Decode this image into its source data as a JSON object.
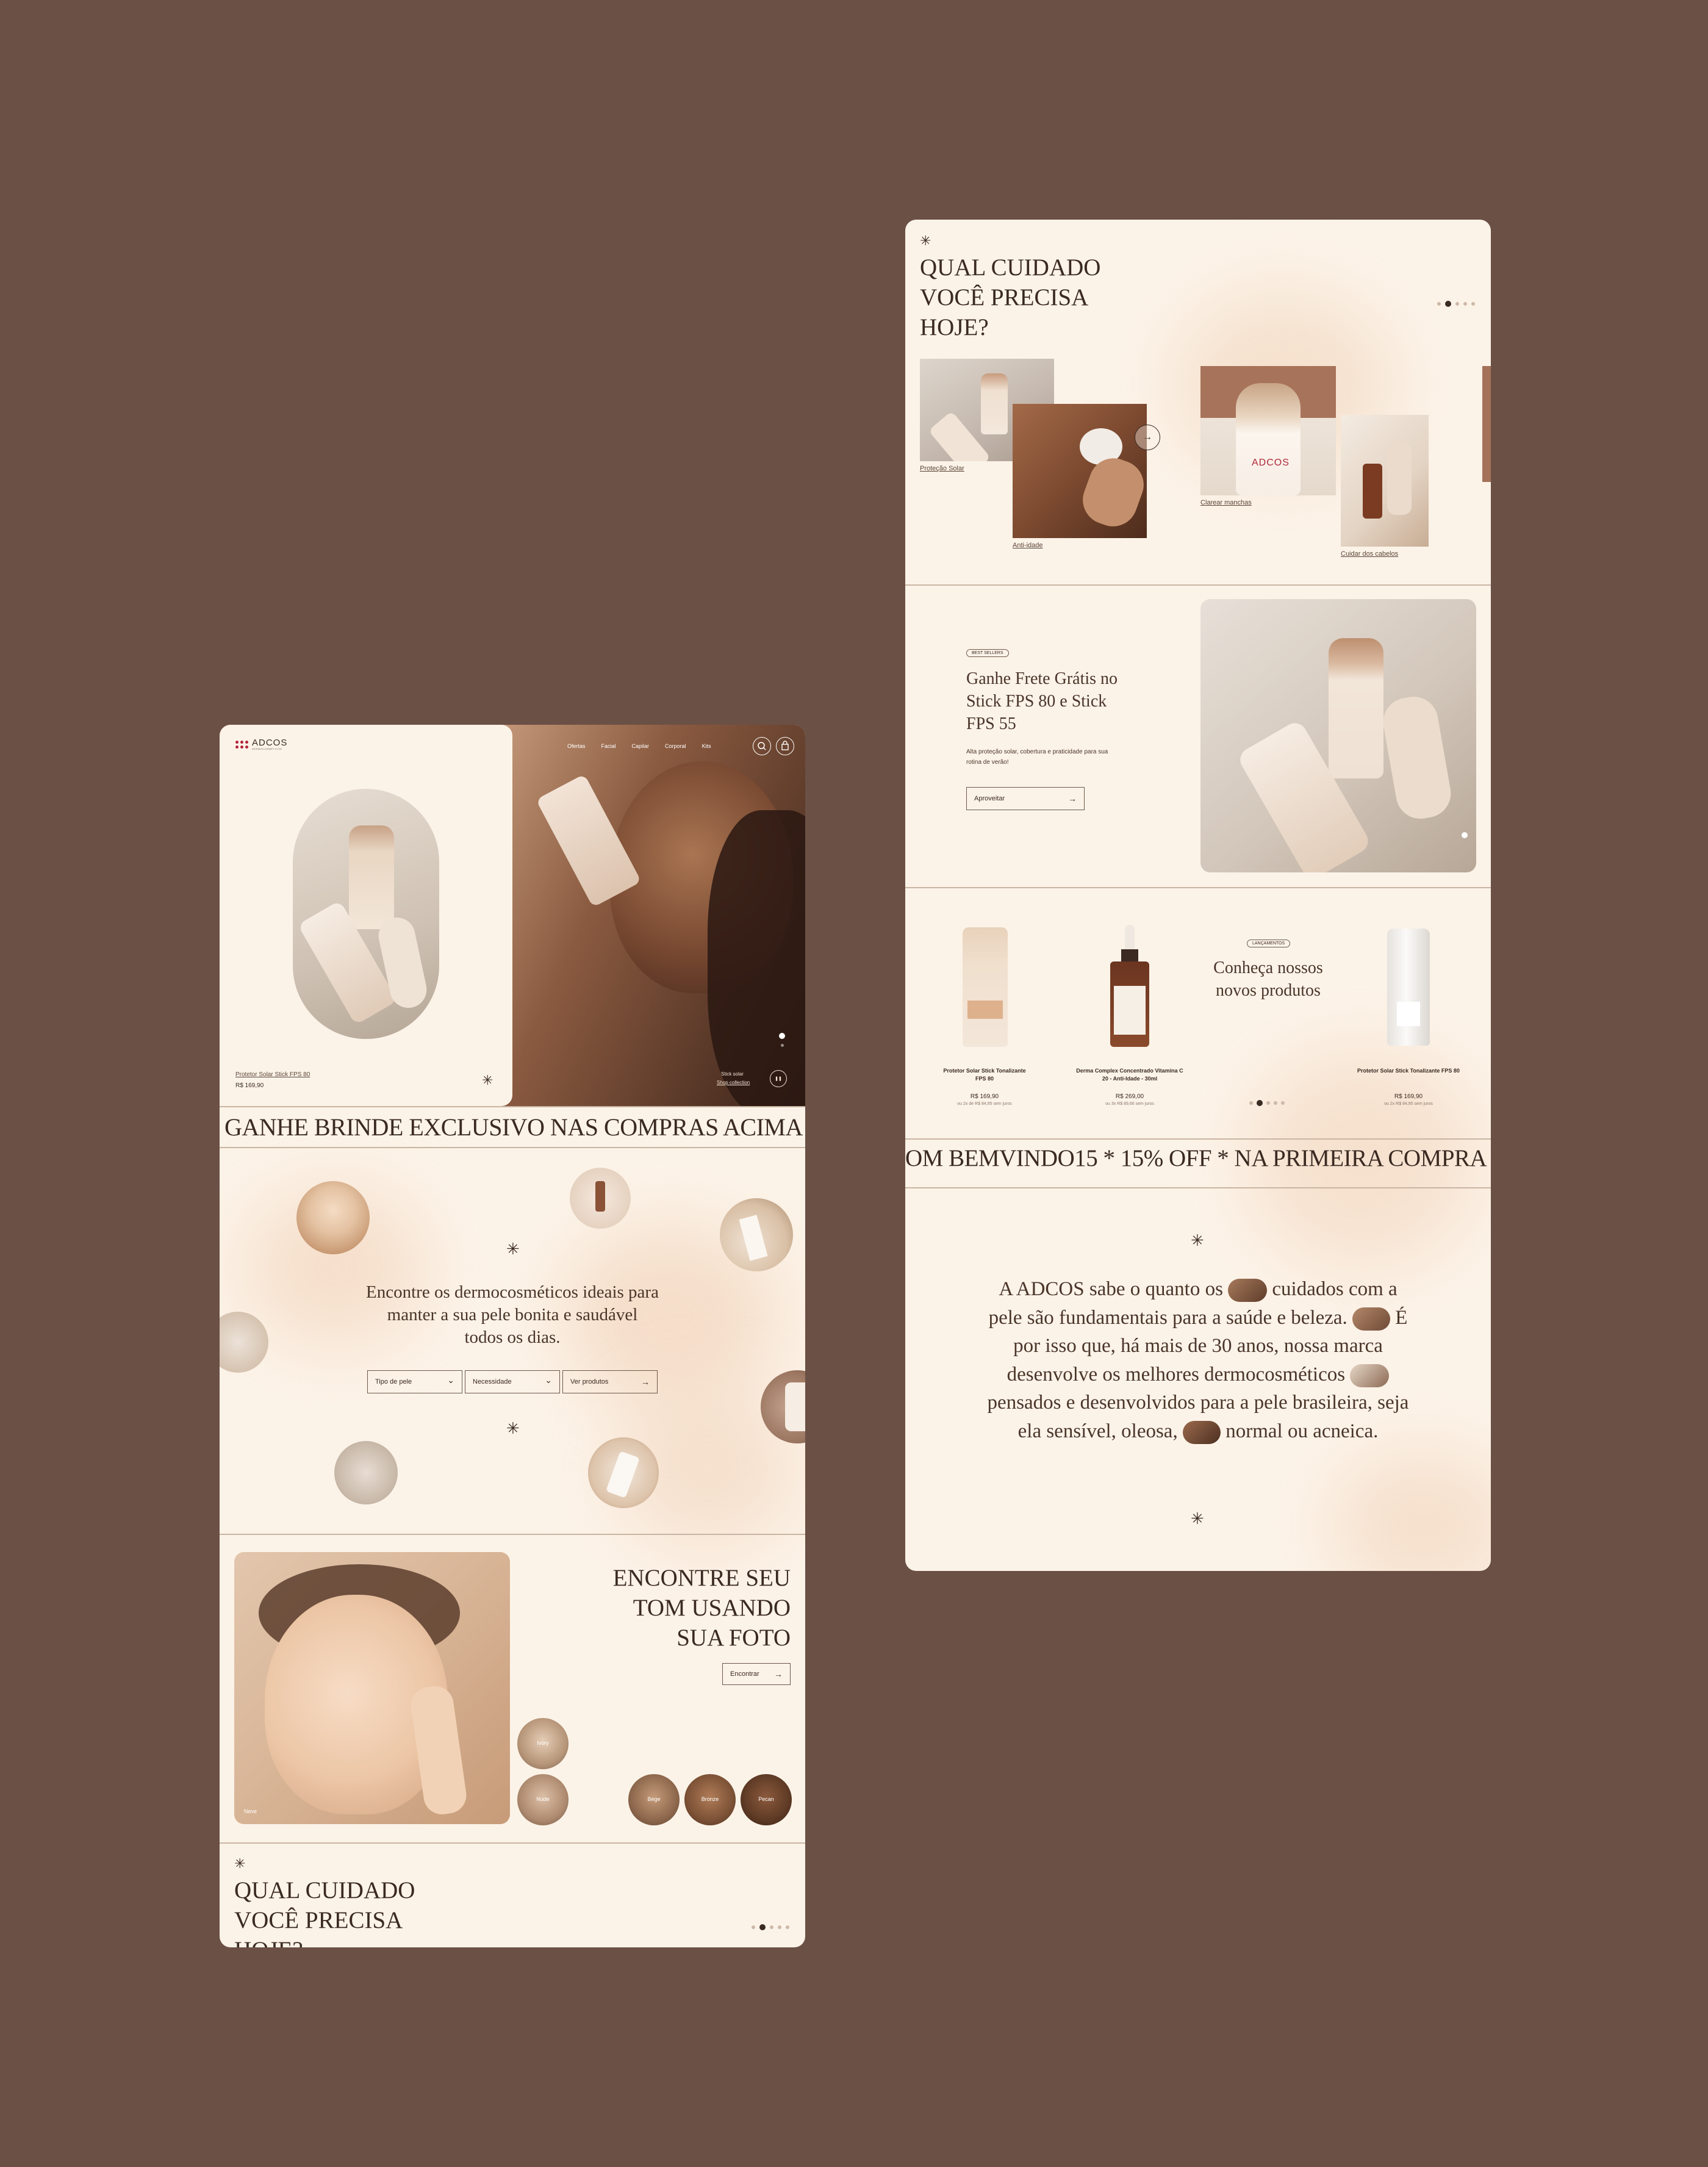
{
  "left": {
    "brand": {
      "name": "ADCOS",
      "tagline": "DERMOCOSMÉTICOS"
    },
    "nav": [
      "Ofertas",
      "Facial",
      "Capilar",
      "Corporal",
      "Kits"
    ],
    "hero": {
      "product_name": "Protetor Solar Stick FPS 80",
      "product_price": "R$ 169,90",
      "caption_top": "Stick solar",
      "caption_link": "Shop collection"
    },
    "marquee": "GANHE BRINDE EXCLUSIVO NAS COMPRAS ACIMA DE",
    "finder": {
      "headline": "Encontre os dermocosméticos ideais para manter a sua pele bonita e saudável todos os dias.",
      "select_skin": "Tipo de pele",
      "select_need": "Necessidade",
      "cta": "Ver produtos"
    },
    "tone": {
      "title": "ENCONTRE SEU TOM USANDO SUA FOTO",
      "cta": "Encontrar",
      "photo_label": "Neve",
      "swatches": [
        "Ivory",
        "Nude",
        "Bege",
        "Bronze",
        "Pecan"
      ]
    },
    "care_title": "QUAL CUIDADO VOCÊ PRECISA HOJE?"
  },
  "right": {
    "care_title": "QUAL CUIDADO VOCÊ PRECISA HOJE?",
    "categories": [
      "Proteção Solar",
      "Anti-idade",
      "Clarear manchas",
      "Cuidar dos cabelos"
    ],
    "promo": {
      "badge": "BEST SELLERS",
      "title": "Ganhe Frete Grátis no Stick FPS 80 e Stick FPS 55",
      "body": "Alta proteção solar, cobertura e praticidade para sua rotina de verão!",
      "cta": "Aproveitar"
    },
    "products": [
      {
        "name": "Protetor Solar Stick Tonalizante FPS 80",
        "price": "R$ 169,90",
        "installments": "ou 2x de R$ 84,95 sem juros"
      },
      {
        "name": "Derma Complex Concentrado Vitamina C 20 - Anti-Idade - 30ml",
        "price": "R$ 269,00",
        "installments": "ou 3x R$ 89,66 sem juros"
      },
      {
        "name": "Protetor Solar Stick Tonalizante FPS 80",
        "price": "R$ 169,90",
        "installments": "ou 2x R$ 84,95 sem juros"
      }
    ],
    "launch": {
      "badge": "LANÇAMENTOS",
      "title": "Conheça nossos novos produtos"
    },
    "marquee": "OM BEMVINDO15 * 15% OFF * NA PRIMEIRA COMPRA NO",
    "about": {
      "part1": "A ADCOS sabe o quanto os",
      "part2": "cuidados com a pele são fundamentais para a saúde e beleza.",
      "part3": "É por isso que, há mais de 30 anos, nossa marca desenvolve os melhores dermocosméticos",
      "part4": "pensados e desenvolvidos para a pele brasileira, seja ela sensível, oleosa,",
      "part5": "normal ou acneica."
    }
  },
  "icons": {
    "spark": "✳",
    "arrow": "→",
    "chevron": "⌄",
    "pause": "❚❚"
  },
  "colors": {
    "background": "#6b5045",
    "panel": "#fcf3e8",
    "text": "#3a2a22",
    "accent": "#b2263a"
  }
}
